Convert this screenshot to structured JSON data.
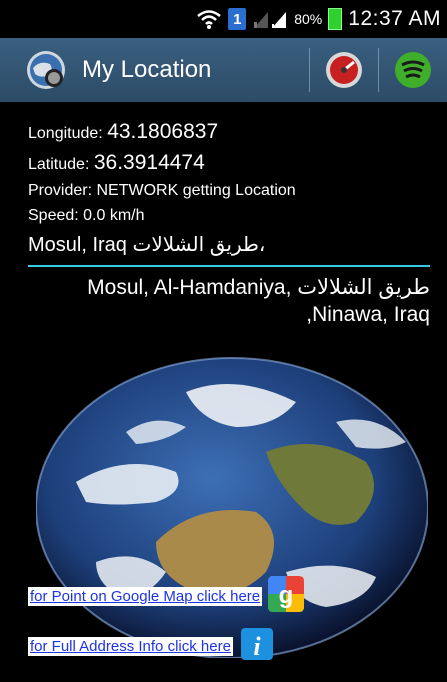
{
  "status_bar": {
    "sim_slot": "1",
    "battery_pct": "80%",
    "time": "12:37 AM",
    "icons": [
      "wifi-icon",
      "sim-icon",
      "signal-icon",
      "signal-icon",
      "battery-icon"
    ]
  },
  "action_bar": {
    "title": "My Location",
    "app_icon": "globe-location-icon",
    "buttons": [
      {
        "name": "gauge-icon"
      },
      {
        "name": "wifi-broadcast-icon"
      }
    ]
  },
  "location": {
    "longitude_label": "Longitude:",
    "longitude_value": "43.1806837",
    "latitude_label": "Latitude:",
    "latitude_value": "36.3914474",
    "provider_text": "Provider:  NETWORK getting Location",
    "speed_text": "Speed: 0.0  km/h",
    "city_line": "Mosul, Iraq طريق الشلالات،",
    "full_address_line1": "Mosul, Al-Hamdaniya, طريق الشلالات",
    "full_address_line2": ",Ninawa, Iraq"
  },
  "links": {
    "google_map": "for Point on Google Map click here",
    "address_info": "for Full Address Info click here"
  },
  "colors": {
    "action_bar": "#2f5270",
    "divider": "#39c8e6",
    "link": "#1d33e6"
  }
}
